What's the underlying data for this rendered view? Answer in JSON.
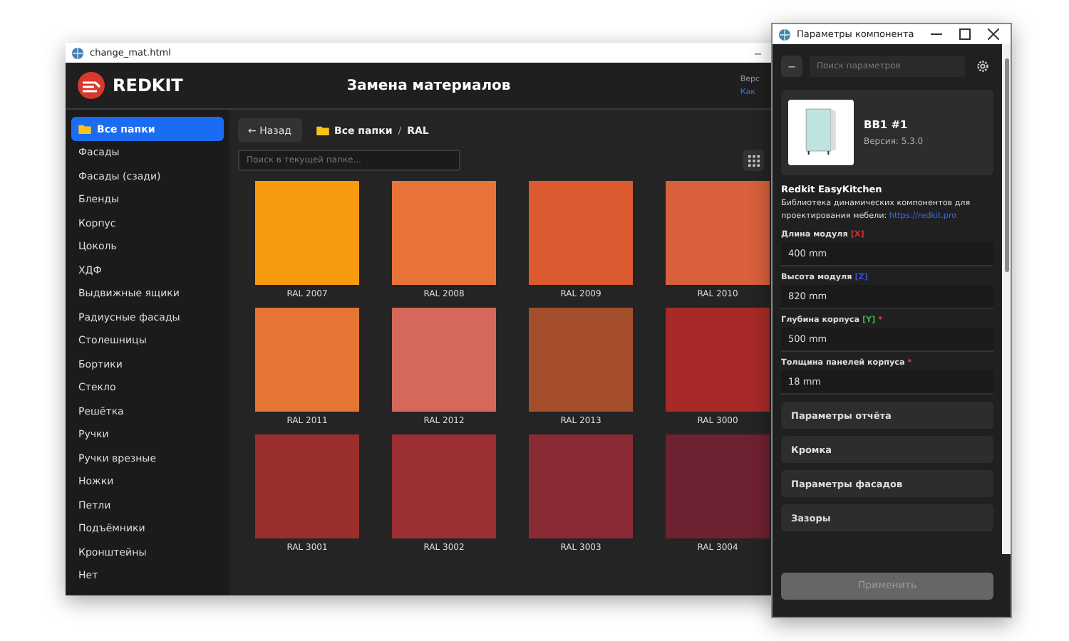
{
  "main_window": {
    "title": "change_mat.html",
    "minimize": "–",
    "brand": "REDKIT",
    "heading": "Замена материалов",
    "version_label": "Верс",
    "version_link": "Как"
  },
  "sidebar": {
    "items": [
      {
        "label": "Все папки",
        "selected": true
      },
      {
        "label": "Фасады",
        "selected": false
      },
      {
        "label": "Фасады (сзади)",
        "selected": false
      },
      {
        "label": "Бленды",
        "selected": false
      },
      {
        "label": "Корпус",
        "selected": false
      },
      {
        "label": "Цоколь",
        "selected": false
      },
      {
        "label": "ХДФ",
        "selected": false
      },
      {
        "label": "Выдвижные ящики",
        "selected": false
      },
      {
        "label": "Радиусные фасады",
        "selected": false
      },
      {
        "label": "Столешницы",
        "selected": false
      },
      {
        "label": "Бортики",
        "selected": false
      },
      {
        "label": "Стекло",
        "selected": false
      },
      {
        "label": "Решётка",
        "selected": false
      },
      {
        "label": "Ручки",
        "selected": false
      },
      {
        "label": "Ручки врезные",
        "selected": false
      },
      {
        "label": "Ножки",
        "selected": false
      },
      {
        "label": "Петли",
        "selected": false
      },
      {
        "label": "Подъёмники",
        "selected": false
      },
      {
        "label": "Кронштейны",
        "selected": false
      },
      {
        "label": "Нет",
        "selected": false
      }
    ]
  },
  "toolbar": {
    "back": "← Назад",
    "breadcrumb": [
      "Все папки",
      "RAL"
    ],
    "separator": "/",
    "search": {
      "placeholder": "Поиск в текущей папке..."
    }
  },
  "swatches": [
    {
      "name": "RAL 2007",
      "color": "#f89a0e"
    },
    {
      "name": "RAL 2008",
      "color": "#e8733a"
    },
    {
      "name": "RAL 2009",
      "color": "#dc5a30"
    },
    {
      "name": "RAL 2010",
      "color": "#d8603a"
    },
    {
      "name": "RAL 2011",
      "color": "#e47533"
    },
    {
      "name": "RAL 2012",
      "color": "#d5685a"
    },
    {
      "name": "RAL 2013",
      "color": "#a54e2b"
    },
    {
      "name": "RAL 3000",
      "color": "#a72a28"
    },
    {
      "name": "RAL 3001",
      "color": "#9b2f2e"
    },
    {
      "name": "RAL 3002",
      "color": "#9c2f33"
    },
    {
      "name": "RAL 3003",
      "color": "#8a2a34"
    },
    {
      "name": "RAL 3004",
      "color": "#6e2130"
    }
  ],
  "params_window": {
    "title": "Параметры компонента",
    "search": {
      "placeholder": "Поиск параметров"
    },
    "collapse": "–",
    "component": {
      "name": "ВВ1 #1",
      "version": "Версия: 5.3.0"
    },
    "library": {
      "name": "Redkit EasyKitchen",
      "description": "Библиотека динамических компонентов для проектирования мебели:",
      "link": "https://redkit.pro"
    },
    "fields": [
      {
        "label": "Длина модуля",
        "axis": "[X]",
        "color": "#d0312d",
        "required": false,
        "value": "400 mm"
      },
      {
        "label": "Высота модуля",
        "axis": "[Z]",
        "color": "#2f4fd8",
        "required": false,
        "value": "820 mm"
      },
      {
        "label": "Глубина корпуса",
        "axis": "[Y]",
        "color": "#3fae49",
        "required": true,
        "value": "500 mm"
      },
      {
        "label": "Толщина панелей корпуса",
        "required": true,
        "value": "18 mm"
      }
    ],
    "required_mark": "*",
    "sections": [
      "Параметры отчёта",
      "Кромка",
      "Параметры фасадов",
      "Зазоры"
    ],
    "apply": {
      "label": "Применить",
      "disabled": true
    }
  }
}
